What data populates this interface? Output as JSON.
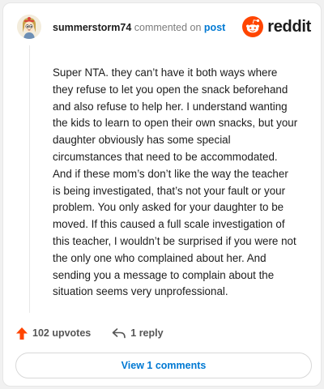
{
  "header": {
    "username": "summerstorm74",
    "commented_on": "commented on",
    "post_link": "post",
    "brand": "reddit"
  },
  "comment": {
    "body": "Super NTA. they can’t have it both ways where they refuse to let you open the snack beforehand and also refuse to help her. I understand wanting the kids to learn to open their own snacks, but your daughter obviously has some special circumstances that need to be accommodated. And if these mom’s don’t like the way the teacher is being investigated, that’s not your fault or your problem. You only asked for your daughter to be moved. If this caused a full scale investigation of this teacher, I wouldn’t be surprised if you were not the only one who complained about her. And sending you a message to complain about the situation seems very unprofessional."
  },
  "actions": {
    "upvotes_label": "102 upvotes",
    "reply_label": "1 reply"
  },
  "footer": {
    "view_comments_label": "View 1 comments"
  },
  "colors": {
    "accent": "#0079d3",
    "upvote": "#ff4500",
    "brand": "#ff4500"
  },
  "icons": {
    "upvote": "upvote-arrow-icon",
    "reply": "reply-arrow-icon",
    "logo": "reddit-alien-icon",
    "avatar": "user-avatar-icon"
  }
}
